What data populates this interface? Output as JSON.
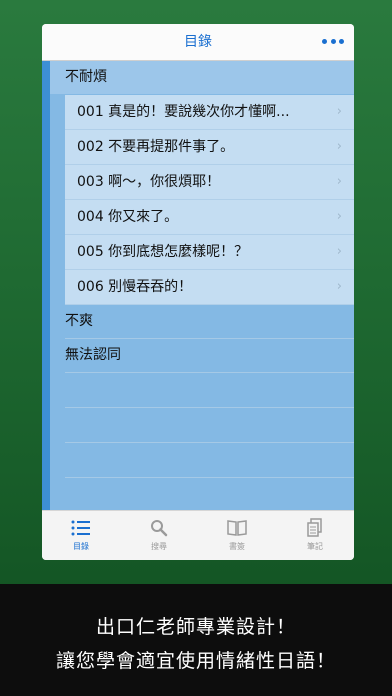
{
  "app": {
    "nav_title": "目錄",
    "more_icon": "more-icon",
    "sections": [
      {
        "title": "不耐煩",
        "expanded": true,
        "items": [
          {
            "label": "001 真是的！要說幾次你才懂啊..."
          },
          {
            "label": "002 不要再提那件事了。"
          },
          {
            "label": "003 啊～，你很煩耶！"
          },
          {
            "label": "004 你又來了。"
          },
          {
            "label": "005 你到底想怎麼樣呢！？"
          },
          {
            "label": "006 別慢吞吞的！"
          }
        ]
      },
      {
        "title": "不爽",
        "expanded": false
      },
      {
        "title": "無法認同",
        "expanded": false
      }
    ],
    "chevron": "›",
    "tabs": [
      {
        "label": "目錄",
        "icon": "list-icon",
        "active": true
      },
      {
        "label": "搜尋",
        "icon": "search-icon",
        "active": false
      },
      {
        "label": "書簽",
        "icon": "book-icon",
        "active": false
      },
      {
        "label": "筆記",
        "icon": "note-icon",
        "active": false
      }
    ]
  },
  "caption": {
    "line1": "出口仁老師專業設計！",
    "line2": "讓您學會適宜使用情緒性日語！"
  },
  "colors": {
    "accent": "#1a6fd0",
    "background_green": "#1f6a32",
    "list_blue": "#84b9e4",
    "item_blue": "#c4ddf2"
  }
}
